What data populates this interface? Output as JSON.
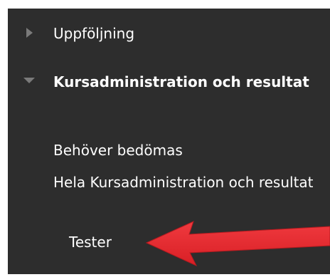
{
  "menu": {
    "items": [
      {
        "label": "Uppföljning",
        "icon": "caret-right-icon",
        "expanded": false
      },
      {
        "label": "Kursadministration och resultat",
        "icon": "caret-down-icon",
        "expanded": true
      }
    ],
    "subitems": [
      {
        "label": "Behöver bedömas"
      },
      {
        "label": "Hela Kursadministration och resultat"
      }
    ],
    "subsubitems": [
      {
        "label": "Tester"
      }
    ]
  },
  "colors": {
    "panel_background": "#2d2d2d",
    "text": "#ffffff",
    "caret": "#7a7a7a",
    "arrow": "#e8262c"
  }
}
